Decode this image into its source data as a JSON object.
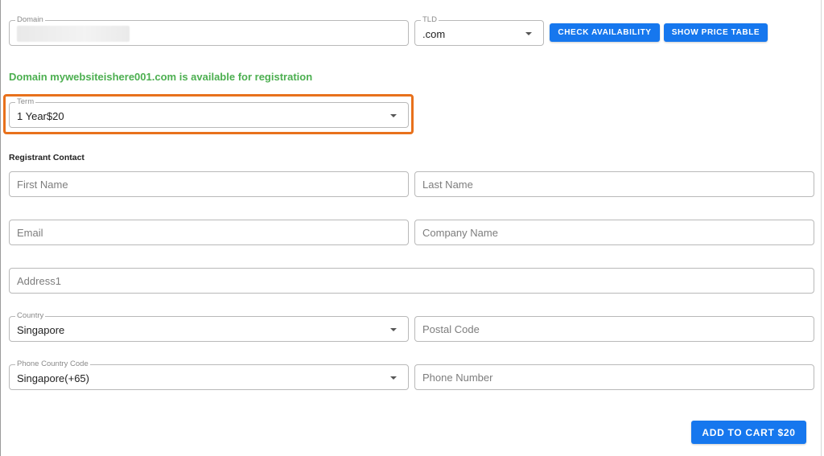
{
  "domain_search": {
    "domain_label": "Domain",
    "domain_value": "",
    "tld_label": "TLD",
    "tld_value": ".com",
    "check_button": "CHECK AVAILABILITY",
    "price_table_button": "SHOW PRICE TABLE"
  },
  "status_message": "Domain mywebsiteishere001.com is available for registration",
  "term": {
    "label": "Term",
    "value": "1 Year$20"
  },
  "registrant": {
    "section_title": "Registrant Contact",
    "first_name_placeholder": "First Name",
    "last_name_placeholder": "Last Name",
    "email_placeholder": "Email",
    "company_placeholder": "Company Name",
    "address_placeholder": "Address1",
    "country_label": "Country",
    "country_value": "Singapore",
    "postal_placeholder": "Postal Code",
    "phone_code_label": "Phone Country Code",
    "phone_code_value": "Singapore(+65)",
    "phone_placeholder": "Phone Number"
  },
  "add_to_cart_button": "ADD TO CART $20",
  "colors": {
    "accent": "#1677ee",
    "success": "#4caf50",
    "highlight": "#e8711c"
  }
}
